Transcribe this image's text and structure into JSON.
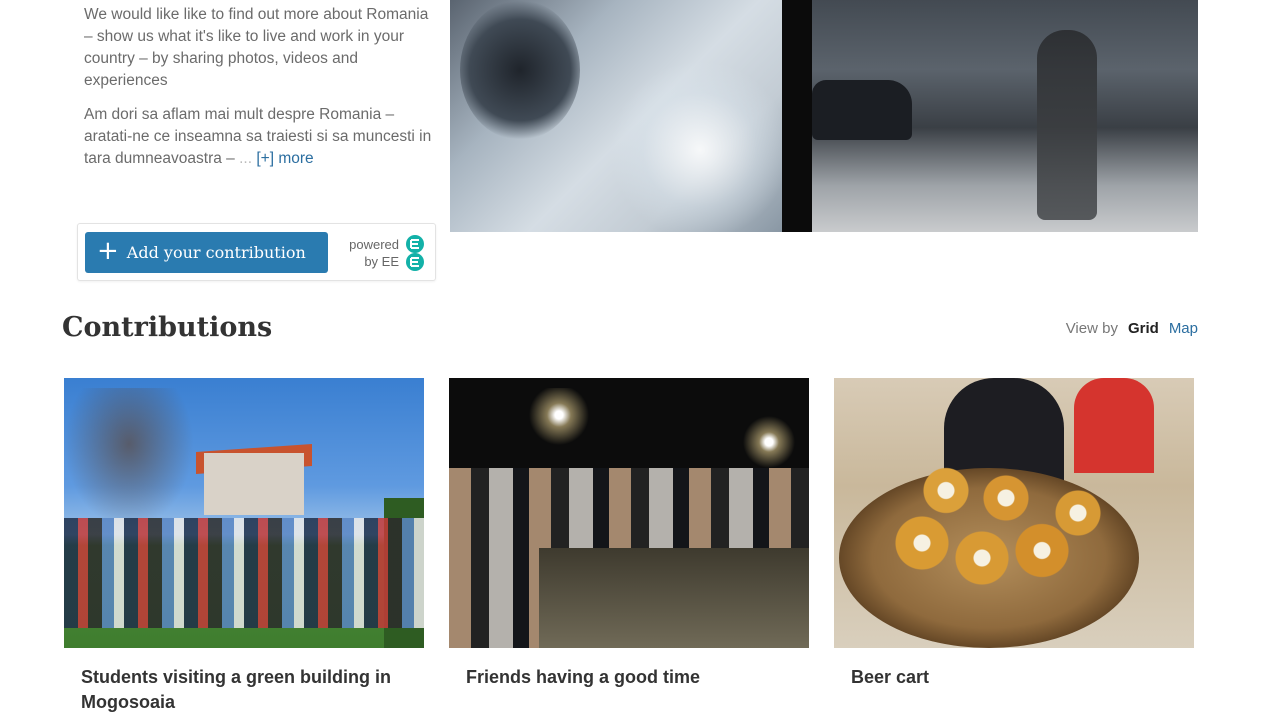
{
  "intro": {
    "paragraph_en": "We would like like to find out more about Romania – show us what it's like to live and work in your country – by sharing photos, videos and experiences",
    "paragraph_ro": "Am dori sa aflam mai mult despre Romania – aratati-ne ce inseamna sa traiesti si sa muncesti in tara dumneavoastra –",
    "ellipsis": "...",
    "more_link": "[+] more"
  },
  "cta": {
    "add_label": "Add your contribution",
    "plus_icon": "plus-icon",
    "powered_line1": "powered",
    "powered_line2": "by EE",
    "ee_logo": "ee-logo-icon",
    "button_color": "#2a7bb0",
    "logo_color": "#13b1a8"
  },
  "section": {
    "title": "Contributions",
    "view_by_label": "View by",
    "grid_label": "Grid",
    "map_label": "Map",
    "link_color": "#2b6ea0"
  },
  "cards": [
    {
      "caption": "Students visiting a green building in Mogosoaia"
    },
    {
      "caption": "Friends having a good time"
    },
    {
      "caption": "Beer cart"
    }
  ]
}
